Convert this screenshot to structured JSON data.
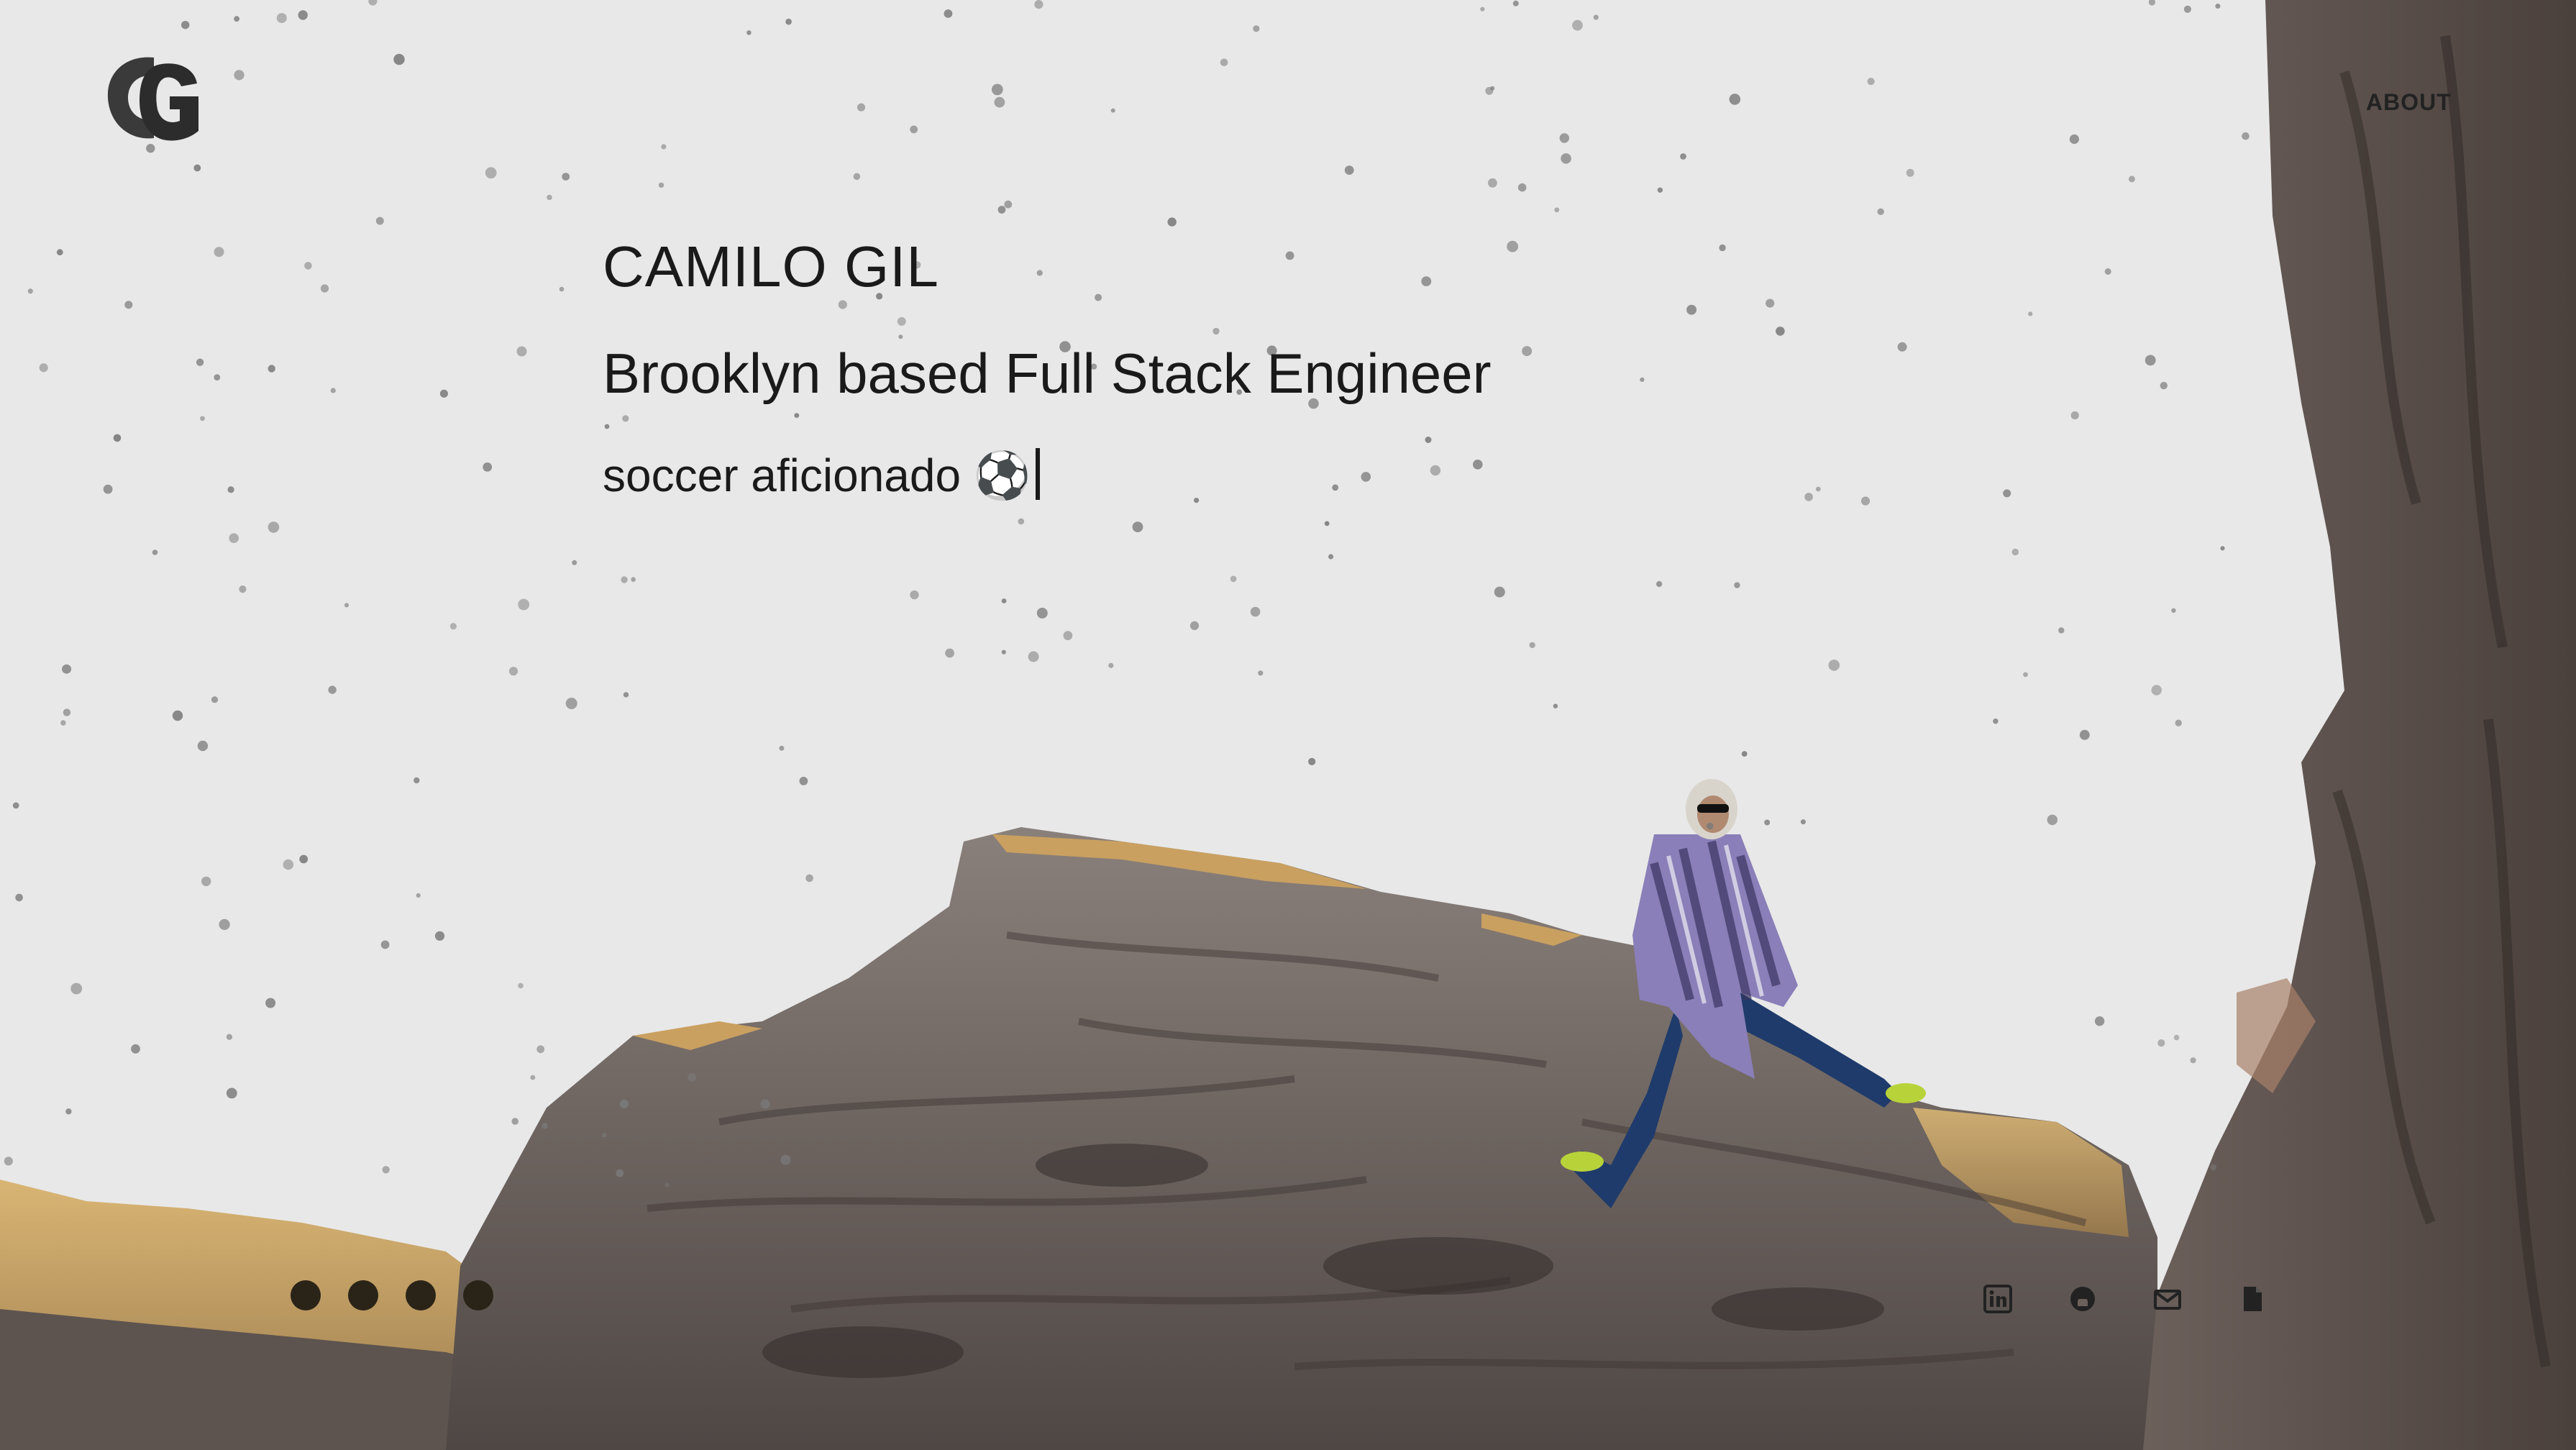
{
  "header": {
    "logo_text": "CG",
    "nav": [
      {
        "label": "ABOUT"
      }
    ]
  },
  "hero": {
    "name": "CAMILO GIL",
    "title": "Brooklyn based Full Stack Engineer",
    "tagline": "soccer aficionado ⚽"
  },
  "carousel": {
    "dot_count": 4
  },
  "socials": [
    {
      "icon": "linkedin-icon"
    },
    {
      "icon": "github-icon"
    },
    {
      "icon": "email-icon"
    },
    {
      "icon": "resume-icon"
    }
  ],
  "colors": {
    "background": "#e8e8e8",
    "text": "#1a1a1a",
    "rock": "#7a6f6b",
    "sunlit_rock": "#c9a060",
    "dot": "#2a2418"
  }
}
